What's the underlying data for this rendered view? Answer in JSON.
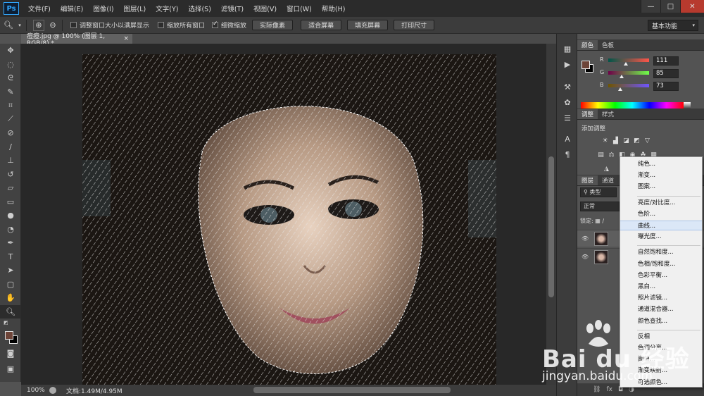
{
  "app": {
    "logo": "Ps"
  },
  "menu": [
    "文件(F)",
    "编辑(E)",
    "图像(I)",
    "图层(L)",
    "文字(Y)",
    "选择(S)",
    "滤镜(T)",
    "视图(V)",
    "窗口(W)",
    "帮助(H)"
  ],
  "window_controls": {
    "minimize": "—",
    "maximize": "□",
    "close": "✕"
  },
  "options": {
    "fit_window_label": "调整窗口大小以满屏显示",
    "zoom_all_label": "缩放所有窗口",
    "scrubby_zoom_label": "细微缩放",
    "actual_pixels": "实际像素",
    "fit_screen": "适合屏幕",
    "fill_screen": "填充屏幕",
    "print_size": "打印尺寸",
    "workspace": "基本功能"
  },
  "document_tab": {
    "title": "痘痘.jpg @ 100% (图层 1, RGB/8) *",
    "close": "×"
  },
  "status": {
    "zoom": "100%",
    "doc_info": "文档:1.49M/4.95M"
  },
  "color_panel": {
    "tabs": [
      "颜色",
      "色板"
    ],
    "fg_color": "#6d4438",
    "sliders": [
      {
        "label": "R",
        "value": "111",
        "fraction": 0.435
      },
      {
        "label": "G",
        "value": "85",
        "fraction": 0.333
      },
      {
        "label": "B",
        "value": "73",
        "fraction": 0.286
      }
    ]
  },
  "adjustments_panel": {
    "tabs": [
      "调整",
      "样式"
    ],
    "title": "添加调整"
  },
  "layers_panel": {
    "tabs": [
      "图层",
      "通道"
    ],
    "filter": "类型",
    "blend_mode": "正常",
    "lock_label": "锁定:"
  },
  "adjustment_menu": {
    "groups": [
      [
        "纯色...",
        "渐变...",
        "图案..."
      ],
      [
        "亮度/对比度...",
        "色阶...",
        "曲线...",
        "曝光度..."
      ],
      [
        "自然饱和度...",
        "色相/饱和度...",
        "色彩平衡...",
        "黑白...",
        "照片滤镜...",
        "通道混合器...",
        "颜色查找..."
      ],
      [
        "反相",
        "色调分离...",
        "阈值...",
        "渐变映射...",
        "可选颜色..."
      ]
    ],
    "highlighted": "曲线..."
  },
  "watermark": {
    "logo": "Bai du 经验",
    "url": "jingyan.baidu.com"
  }
}
